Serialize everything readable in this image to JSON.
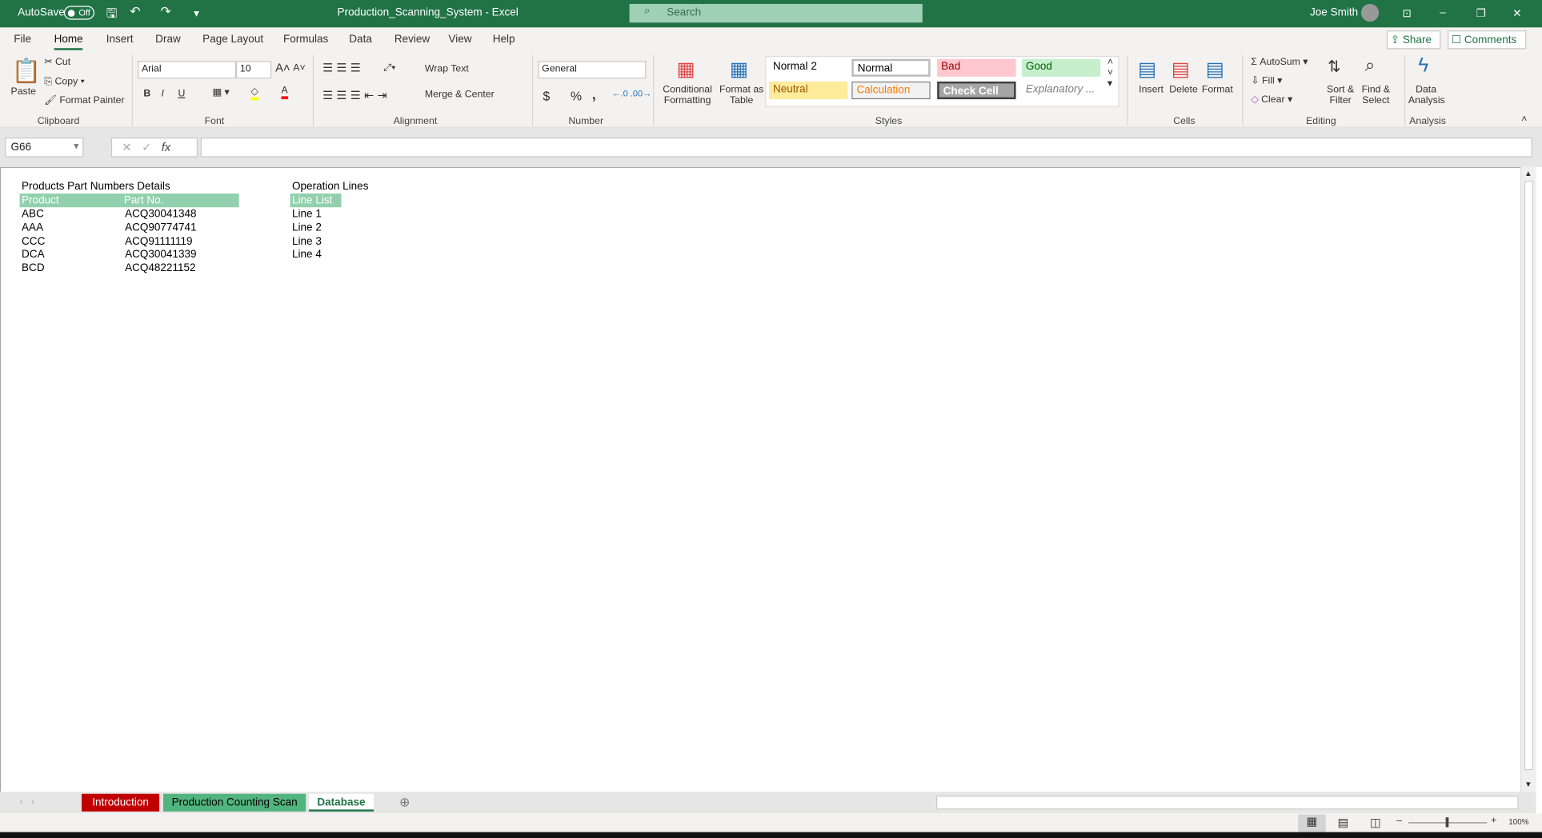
{
  "titlebar": {
    "autosave_label": "AutoSave",
    "autosave_state": "Off",
    "doc_title": "Production_Scanning_System  -  Excel",
    "search_placeholder": "Search",
    "user_name": "Joe Smith"
  },
  "menu_tabs": [
    "File",
    "Home",
    "Insert",
    "Draw",
    "Page Layout",
    "Formulas",
    "Data",
    "Review",
    "View",
    "Help"
  ],
  "active_tab": "Home",
  "share_label": "Share",
  "comments_label": "Comments",
  "clipboard": {
    "paste": "Paste",
    "cut": "Cut",
    "copy": "Copy",
    "format_painter": "Format Painter",
    "group": "Clipboard"
  },
  "font": {
    "name": "Arial",
    "size": "10",
    "group": "Font",
    "bold": "B",
    "italic": "I",
    "underline": "U",
    "fill_color": "#ffff00",
    "font_color": "#ff0000"
  },
  "alignment": {
    "wrap_text": "Wrap Text",
    "merge_center": "Merge & Center",
    "group": "Alignment"
  },
  "number": {
    "format": "General",
    "currency": "$",
    "percent": "%",
    "comma": ",",
    "group": "Number"
  },
  "styles": {
    "conditional": "Conditional Formatting",
    "format_table": "Format as Table",
    "group": "Styles",
    "items": [
      {
        "label": "Normal 2",
        "bg": "#ffffff",
        "fg": "#000000"
      },
      {
        "label": "Normal",
        "bg": "#ffffff",
        "fg": "#000000"
      },
      {
        "label": "Bad",
        "bg": "#ffc7ce",
        "fg": "#9c0006"
      },
      {
        "label": "Good",
        "bg": "#c6efce",
        "fg": "#006100"
      },
      {
        "label": "Neutral",
        "bg": "#ffeb9c",
        "fg": "#9c5700"
      },
      {
        "label": "Calculation",
        "bg": "#f2f2f2",
        "fg": "#fa7d00"
      },
      {
        "label": "Check Cell",
        "bg": "#a5a5a5",
        "fg": "#ffffff"
      },
      {
        "label": "Explanatory ...",
        "bg": "#ffffff",
        "fg": "#7f7f7f"
      }
    ]
  },
  "cells": {
    "insert": "Insert",
    "delete": "Delete",
    "format": "Format",
    "group": "Cells"
  },
  "editing": {
    "autosum": "AutoSum",
    "fill": "Fill",
    "clear": "Clear",
    "sort_filter": "Sort & Filter",
    "find_select": "Find & Select",
    "group": "Editing"
  },
  "analysis": {
    "data_analysis": "Data Analysis",
    "group": "Analysis"
  },
  "formula_bar": {
    "name_box": "G66",
    "fx": "fx",
    "formula": ""
  },
  "sheet": {
    "products_title": "Products Part Numbers Details",
    "products_headers": [
      "Product",
      "Part No."
    ],
    "products": [
      [
        "ABC",
        "ACQ30041348"
      ],
      [
        "AAA",
        "ACQ90774741"
      ],
      [
        "CCC",
        "ACQ91111119"
      ],
      [
        "DCA",
        "ACQ30041339"
      ],
      [
        "BCD",
        "ACQ48221152"
      ]
    ],
    "lines_title": "Operation Lines",
    "lines_header": "Line List",
    "lines": [
      "Line 1",
      "Line 2",
      "Line 3",
      "Line 4"
    ],
    "header_color": "#92d0ad"
  },
  "sheet_tabs": [
    {
      "label": "Introduction",
      "bg": "#c00000",
      "fg": "#ffffff"
    },
    {
      "label": "Production Counting Scan",
      "bg": "#52b47e",
      "fg": "#000000"
    },
    {
      "label": "Database",
      "bg": "#ffffff",
      "fg": "#217346"
    }
  ],
  "active_sheet": "Database",
  "zoom": "100%"
}
